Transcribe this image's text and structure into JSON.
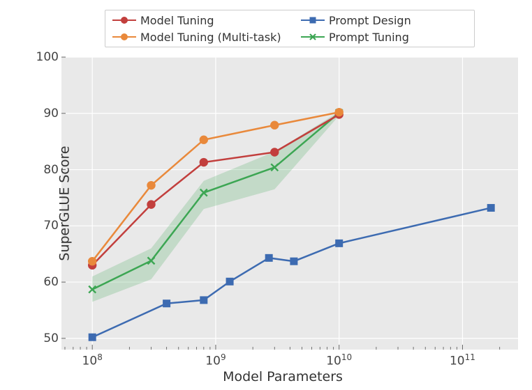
{
  "chart_data": {
    "type": "line",
    "xlabel": "Model Parameters",
    "ylabel": "SuperGLUE Score",
    "xscale": "log",
    "ylim": [
      48,
      100
    ],
    "y_ticks": [
      50,
      60,
      70,
      80,
      90,
      100
    ],
    "x_ticks_exp": [
      8,
      9,
      10,
      11
    ],
    "series": [
      {
        "name": "Model Tuning",
        "color": "#c23f3d",
        "marker": "circle",
        "x": [
          100000000.0,
          300000000.0,
          800000000.0,
          3000000000.0,
          10000000000.0
        ],
        "y": [
          63.0,
          73.8,
          81.3,
          83.1,
          89.8
        ]
      },
      {
        "name": "Model Tuning (Multi-task)",
        "color": "#e9893b",
        "marker": "circle",
        "x": [
          100000000.0,
          300000000.0,
          800000000.0,
          3000000000.0,
          10000000000.0
        ],
        "y": [
          63.7,
          77.2,
          85.3,
          87.9,
          90.2
        ]
      },
      {
        "name": "Prompt Design",
        "color": "#3d6bb1",
        "marker": "square",
        "x": [
          100000000.0,
          400000000.0,
          800000000.0,
          1300000000.0,
          2700000000.0,
          4300000000.0,
          10000000000.0,
          170000000000.0
        ],
        "y": [
          50.2,
          56.2,
          56.8,
          60.1,
          64.3,
          63.7,
          66.9,
          73.2
        ]
      },
      {
        "name": "Prompt Tuning",
        "color": "#3ca653",
        "marker": "x",
        "x": [
          100000000.0,
          300000000.0,
          800000000.0,
          3000000000.0,
          10000000000.0
        ],
        "y": [
          58.7,
          63.8,
          75.9,
          80.4,
          90.1
        ],
        "band": [
          [
            56.5,
            61.0
          ],
          [
            60.5,
            66.0
          ],
          [
            73.0,
            78.0
          ],
          [
            76.5,
            83.2
          ],
          [
            89.6,
            90.3
          ]
        ]
      }
    ],
    "legend_order": [
      "Model Tuning",
      "Model Tuning (Multi-task)",
      "Prompt Design",
      "Prompt Tuning"
    ]
  },
  "legend": {
    "items": [
      {
        "label": "Model Tuning"
      },
      {
        "label": "Model Tuning (Multi-task)"
      },
      {
        "label": "Prompt Design"
      },
      {
        "label": "Prompt Tuning"
      }
    ]
  },
  "axes": {
    "x_title": "Model Parameters",
    "y_title": "SuperGLUE Score",
    "x_tick_labels": [
      "10^8",
      "10^9",
      "10^10",
      "10^11"
    ],
    "y_tick_labels": [
      "50",
      "60",
      "70",
      "80",
      "90",
      "100"
    ]
  }
}
